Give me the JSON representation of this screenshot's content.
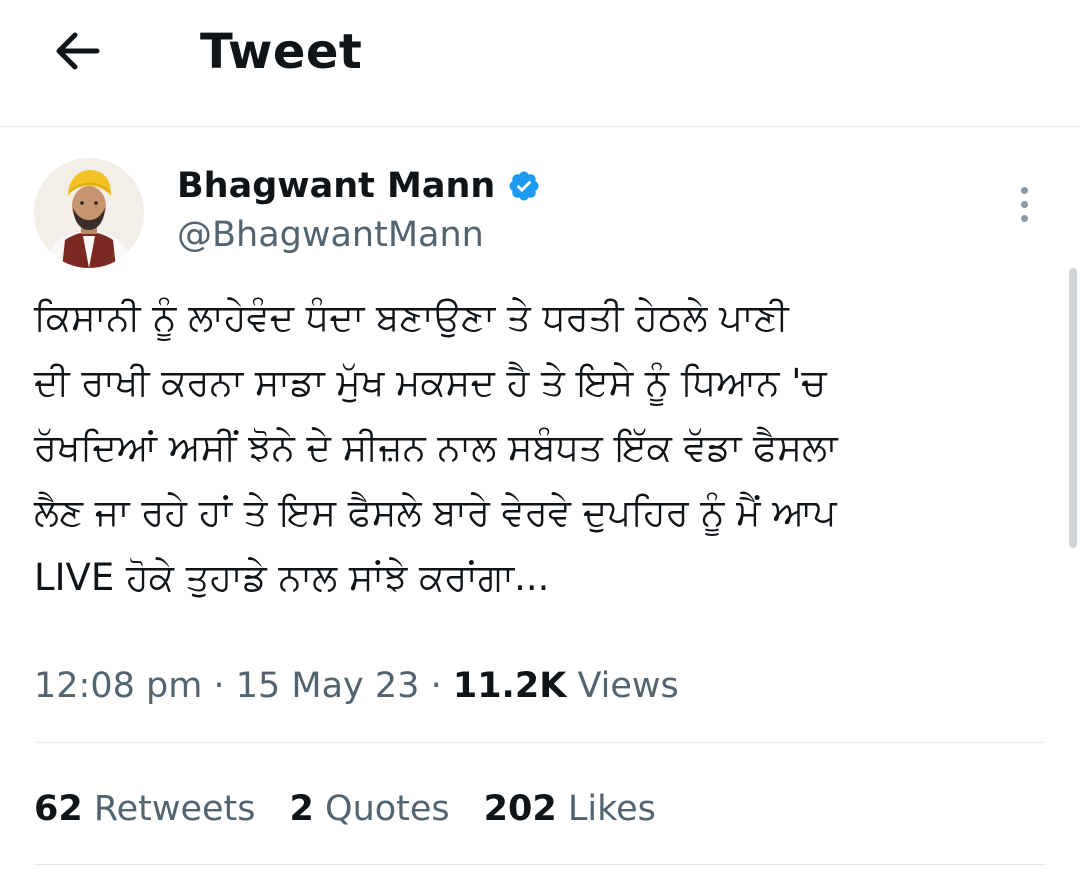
{
  "header": {
    "title": "Tweet",
    "back_icon": "arrow-left-icon"
  },
  "author": {
    "name": "Bhagwant Mann",
    "handle": "@BhagwantMann",
    "verified": true,
    "badge_color": "#1d9bf0",
    "avatar_icon": "profile-photo"
  },
  "tweet": {
    "lines": [
      "ਕਿਸਾਨੀ ਨੂੰ ਲਾਹੇਵੰਦ ਧੰਦਾ ਬਣਾਉਣਾ ਤੇ ਧਰਤੀ ਹੇਠਲੇ ਪਾਣੀ",
      "ਦੀ ਰਾਖੀ ਕਰਨਾ ਸਾਡਾ ਮੁੱਖ ਮਕਸਦ ਹੈ ਤੇ ਇਸੇ ਨੂੰ ਧਿਆਨ 'ਚ",
      "ਰੱਖਦਿਆਂ ਅਸੀਂ ਝੋਨੇ ਦੇ ਸੀਜ਼ਨ ਨਾਲ ਸਬੰਧਤ ਇੱਕ ਵੱਡਾ ਫੈਸਲਾ",
      "ਲੈਣ ਜਾ ਰਹੇ ਹਾਂ ਤੇ ਇਸ ਫੈਸਲੇ ਬਾਰੇ ਵੇਰਵੇ ਦੁਪਹਿਰ ਨੂੰ ਮੈਂ ਆਪ",
      "LIVE ਹੋਕੇ ਤੁਹਾਡੇ ਨਾਲ ਸਾਂਝੇ ਕਰਾਂਗਾ..."
    ]
  },
  "meta": {
    "time": "12:08 pm",
    "separator": "·",
    "date": "15 May 23",
    "views_count": "11.2K",
    "views_label": "Views"
  },
  "stats": {
    "retweets_count": "62",
    "retweets_label": "Retweets",
    "quotes_count": "2",
    "quotes_label": "Quotes",
    "likes_count": "202",
    "likes_label": "Likes"
  },
  "colors": {
    "text": "#0f1419",
    "secondary": "#536471",
    "divider": "#e7e9ea",
    "accent": "#1d9bf0"
  },
  "more_icon": "more-vertical-icon"
}
